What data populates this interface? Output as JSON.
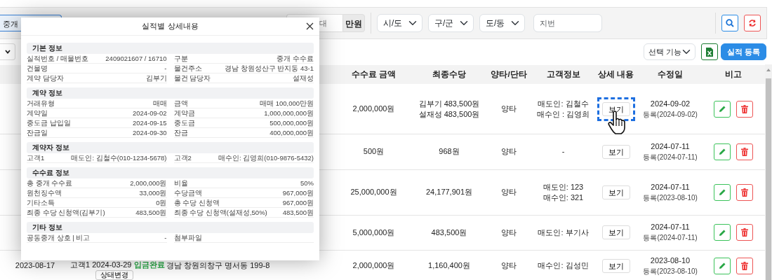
{
  "filter_bar": {
    "type_field": "중개",
    "max_field": {
      "placeholder": "대"
    },
    "unit": "만원",
    "selects": [
      "시/도",
      "구/군",
      "도/동"
    ],
    "lot_field": {
      "placeholder": "지번"
    }
  },
  "toolbar": {
    "action_select": "선택 기능",
    "register_button": "실적 등록"
  },
  "table": {
    "columns": [
      "수수료 금액",
      "최종수당",
      "양타/단타",
      "고객정보",
      "상세 내용",
      "수정일",
      "비고"
    ],
    "rows": [
      {
        "fee": "2,000,000원",
        "final": [
          "김부기 483,500원",
          "설재성 483,500원"
        ],
        "deal": "양타",
        "customer": [
          "매도인: 김철수",
          "매수인 : 김영희"
        ],
        "view": "보기",
        "highlighted": true,
        "modified": "2024-09-02",
        "registered": "등록(2024-09-02)"
      },
      {
        "fee": "500원",
        "final": [
          "968원"
        ],
        "deal": "양타",
        "customer": [
          "-"
        ],
        "view": "보기",
        "highlighted": false,
        "modified": "2024-07-11",
        "registered": "등록(2024-07-11)"
      },
      {
        "fee": "25,000,000원",
        "final": [
          "24,177,901원"
        ],
        "deal": "양타",
        "customer": [
          "매도인: 123",
          "매수인: 321"
        ],
        "view": "보기",
        "highlighted": false,
        "modified": "2024-07-11",
        "registered": "등록(2023-08-10)"
      },
      {
        "fee": "5,000,000원",
        "final": [
          "483,500원"
        ],
        "deal": "양타",
        "customer": [
          "매도인: 부기사"
        ],
        "view": "보기",
        "highlighted": false,
        "modified": "2024-07-11",
        "registered": "등록(2024-07-11)"
      },
      {
        "date": "2023-08-17",
        "customer_line": "고객1 2024-03-29",
        "status": "입금완료",
        "status_button": "상태변경",
        "address": "경남 창원의창구 명서동 199-8",
        "fee": "2,000,000원",
        "final": [
          "1,160,400원"
        ],
        "deal": "양타",
        "customer": [
          "매수인: 김성민"
        ],
        "view": "보기",
        "highlighted": false,
        "modified": "2023-08-10",
        "registered": "등록(2023-08-10)"
      }
    ]
  },
  "modal": {
    "title": "실적별 상세내용",
    "sections": [
      {
        "title": "기본 정보",
        "rows": [
          [
            {
              "label": "실적번호 / 매물번호",
              "value": "2409021607 / 16710"
            },
            {
              "label": "구분",
              "value": "중개 수수료"
            }
          ],
          [
            {
              "label": "건물명",
              "value": "-"
            },
            {
              "label": "물건주소",
              "value": "경남 창원성산구 반지동 43-1"
            }
          ],
          [
            {
              "label": "계약 담당자",
              "value": "김부기"
            },
            {
              "label": "물건 담당자",
              "value": "설재성"
            }
          ]
        ]
      },
      {
        "title": "계약 정보",
        "rows": [
          [
            {
              "label": "거래유형",
              "value": "매매"
            },
            {
              "label": "금액",
              "value": "매매 100,000만원"
            }
          ],
          [
            {
              "label": "계약일",
              "value": "2024-09-02"
            },
            {
              "label": "계약금",
              "value": "1,000,000,000원"
            }
          ],
          [
            {
              "label": "중도금 납입일",
              "value": "2024-09-15"
            },
            {
              "label": "중도금",
              "value": "500,000,000원"
            }
          ],
          [
            {
              "label": "잔금일",
              "value": "2024-09-30"
            },
            {
              "label": "잔금",
              "value": "400,000,000원"
            }
          ]
        ]
      },
      {
        "title": "계약자 정보",
        "rows": [
          [
            {
              "label": "고객1",
              "value": "매도인: 김철수(010-1234-5678)"
            },
            {
              "label": "고객2",
              "value": "매수인: 김영희(010-9876-5432)"
            }
          ]
        ]
      },
      {
        "title": "수수료 정보",
        "rows": [
          [
            {
              "label": "총 중개 수수료",
              "value": "2,000,000원"
            },
            {
              "label": "비율",
              "value": "50%"
            }
          ],
          [
            {
              "label": "원천징수액",
              "value": "33,000원"
            },
            {
              "label": "수당금액",
              "value": "967,000원"
            }
          ],
          [
            {
              "label": "기타소득",
              "value": "0원"
            },
            {
              "label": "총 수당 신청액",
              "value": "967,000원"
            }
          ],
          [
            {
              "label": "최종 수당 신청액(김부기)",
              "value": "483,500원"
            },
            {
              "label": "최종 수당 신청액(설재성,50%)",
              "value": "483,500원"
            }
          ]
        ]
      },
      {
        "title": "기타 정보",
        "rows": [
          [
            {
              "label": "공동중개 상호 | 비고",
              "value": "-"
            },
            {
              "label": "첨부파일"
            }
          ]
        ]
      }
    ]
  }
}
